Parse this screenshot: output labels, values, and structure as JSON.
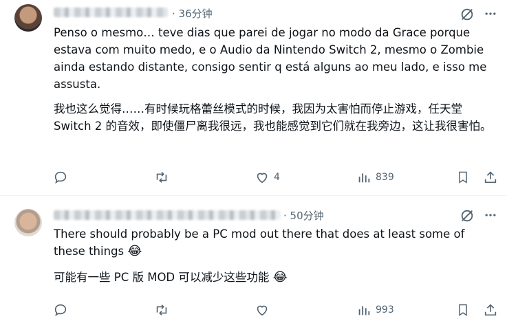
{
  "posts": [
    {
      "time": "· 36分钟",
      "text_original": "Penso o mesmo… teve dias que parei de jogar no modo da Grace porque estava com muito medo, e o Audio da Nintendo Switch 2, mesmo o Zombie ainda estando distante, consigo sentir q está alguns ao meu lado, e isso me assusta.",
      "text_translated": "我也这么觉得……有时候玩格蕾丝模式的时候，我因为太害怕而停止游戏，任天堂 Switch 2 的音效，即使僵尸离我很远，我也能感觉到它们就在我旁边，这让我很害怕。",
      "likes": "4",
      "views": "839"
    },
    {
      "time": "· 50分钟",
      "text_original": "There should probably be a PC mod out there that does at least some of these things",
      "text_original_emoji": "😂",
      "text_translated": "可能有一些 PC 版 MOD 可以减少这些功能",
      "text_translated_emoji": "😂",
      "likes": "",
      "views": "993"
    }
  ],
  "icons": [
    "reply-icon",
    "retweet-icon",
    "like-icon",
    "views-icon",
    "bookmark-icon",
    "share-icon",
    "grok-icon",
    "more-icon"
  ]
}
